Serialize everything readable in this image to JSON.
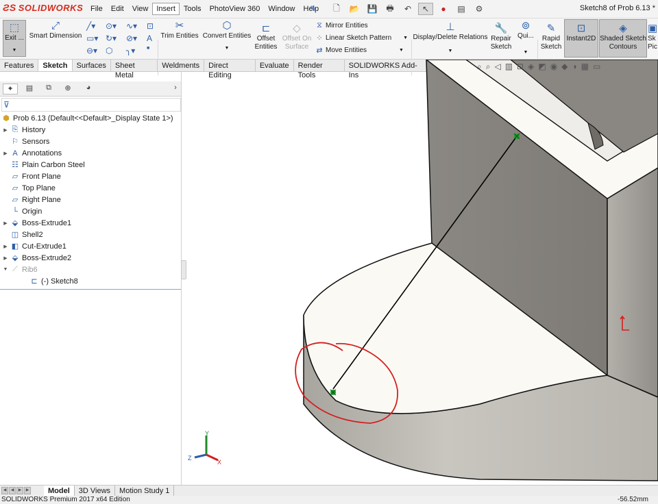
{
  "app": {
    "brand": "SOLIDWORKS",
    "document_title": "Sketch8 of Prob 6.13 *"
  },
  "menu": [
    "File",
    "Edit",
    "View",
    "Insert",
    "Tools",
    "PhotoView 360",
    "Window",
    "Help"
  ],
  "menu_selected": "Insert",
  "ribbon": {
    "exit_sketch": "Exit ...",
    "smart_dimension": "Smart Dimension",
    "trim_entities": "Trim Entities",
    "convert_entities": "Convert Entities",
    "offset_entities": [
      "Offset",
      "Entities"
    ],
    "offset_on_surface": [
      "Offset On",
      "Surface"
    ],
    "mirror_entities": "Mirror Entities",
    "linear_sketch_pattern": "Linear Sketch Pattern",
    "move_entities": "Move Entities",
    "display_delete_relations": "Display/Delete Relations",
    "repair_sketch": [
      "Repair",
      "Sketch"
    ],
    "quick_snaps": "Qui...",
    "rapid_sketch": [
      "Rapid",
      "Sketch"
    ],
    "instant2d": "Instant2D",
    "shaded_sketch_contours": [
      "Shaded Sketch",
      "Contours"
    ],
    "sketch_picture_partial": [
      "Sk",
      "Pic"
    ]
  },
  "tabs": [
    "Features",
    "Sketch",
    "Surfaces",
    "Sheet Metal",
    "Weldments",
    "Direct Editing",
    "Evaluate",
    "Render Tools",
    "SOLIDWORKS Add-Ins"
  ],
  "tab_selected": "Sketch",
  "tree": {
    "root": "Prob 6.13  (Default<<Default>_Display State 1>)",
    "items": [
      {
        "label": "History",
        "icon": "history-icon",
        "expandable": true
      },
      {
        "label": "Sensors",
        "icon": "sensors-icon",
        "expandable": false
      },
      {
        "label": "Annotations",
        "icon": "annotations-icon",
        "expandable": true
      },
      {
        "label": "Plain Carbon Steel",
        "icon": "material-icon",
        "expandable": false
      },
      {
        "label": "Front Plane",
        "icon": "plane-icon",
        "expandable": false
      },
      {
        "label": "Top Plane",
        "icon": "plane-icon",
        "expandable": false
      },
      {
        "label": "Right Plane",
        "icon": "plane-icon",
        "expandable": false
      },
      {
        "label": "Origin",
        "icon": "origin-icon",
        "expandable": false
      },
      {
        "label": "Boss-Extrude1",
        "icon": "extrude-icon",
        "expandable": true
      },
      {
        "label": "Shell2",
        "icon": "shell-icon",
        "expandable": false
      },
      {
        "label": "Cut-Extrude1",
        "icon": "cut-extrude-icon",
        "expandable": true
      },
      {
        "label": "Boss-Extrude2",
        "icon": "extrude-icon",
        "expandable": true
      },
      {
        "label": "Rib6",
        "icon": "rib-icon",
        "expandable": true,
        "greyed": true
      },
      {
        "label": "(-) Sketch8",
        "icon": "sketch-icon",
        "expandable": false,
        "child": true
      }
    ]
  },
  "bottom_tabs": [
    "Model",
    "3D Views",
    "Motion Study 1"
  ],
  "bottom_tab_selected": "Model",
  "status": {
    "left": "SOLIDWORKS Premium 2017 x64 Edition",
    "right": "-56.52mm"
  },
  "axes": {
    "x": "X",
    "y": "Y",
    "z": "Z"
  },
  "colors": {
    "brand_red": "#d52b1e",
    "accent_blue": "#2d5fa8",
    "annotation_red": "#d42020",
    "endpoint_green": "#1fa02a"
  }
}
